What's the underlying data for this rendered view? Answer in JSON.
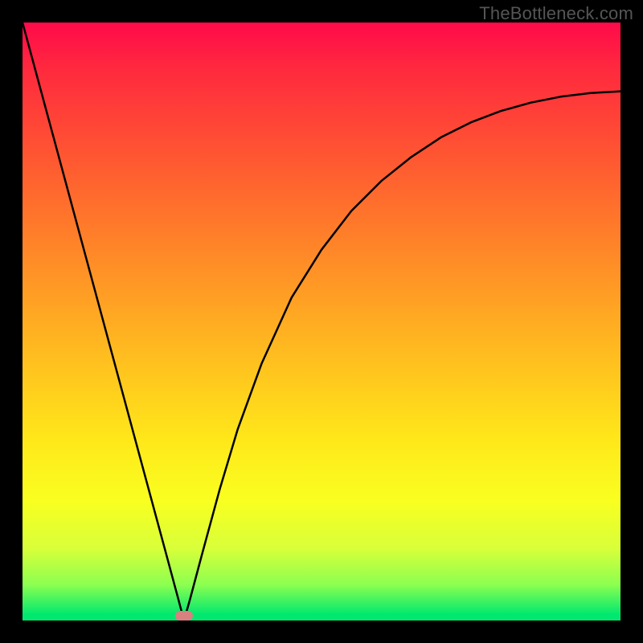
{
  "watermark": "TheBottleneck.com",
  "chart_data": {
    "type": "line",
    "title": "",
    "xlabel": "",
    "ylabel": "",
    "xlim": [
      0,
      100
    ],
    "ylim": [
      0,
      100
    ],
    "grid": false,
    "legend": false,
    "series": [
      {
        "name": "curve",
        "x": [
          0,
          5,
          10,
          15,
          20,
          24,
          26,
          27,
          28,
          30,
          33,
          36,
          40,
          45,
          50,
          55,
          60,
          65,
          70,
          75,
          80,
          85,
          90,
          95,
          100
        ],
        "y": [
          100,
          81.5,
          63,
          44.5,
          26,
          11.2,
          3.8,
          0,
          3.5,
          11,
          22,
          32,
          43,
          54,
          62,
          68.5,
          73.5,
          77.5,
          80.8,
          83.3,
          85.2,
          86.6,
          87.6,
          88.2,
          88.5
        ]
      }
    ],
    "marker": {
      "x": 27,
      "y": 0.8,
      "color": "#d98080"
    },
    "gradient_stops": [
      {
        "pos": 0,
        "color": "#ff0a4a"
      },
      {
        "pos": 8,
        "color": "#ff2a3e"
      },
      {
        "pos": 22,
        "color": "#ff5532"
      },
      {
        "pos": 34,
        "color": "#ff7a2a"
      },
      {
        "pos": 46,
        "color": "#ff9f24"
      },
      {
        "pos": 58,
        "color": "#ffc41e"
      },
      {
        "pos": 70,
        "color": "#ffe81a"
      },
      {
        "pos": 80,
        "color": "#f9ff20"
      },
      {
        "pos": 88,
        "color": "#d8ff3a"
      },
      {
        "pos": 94,
        "color": "#8cff50"
      },
      {
        "pos": 99,
        "color": "#00e86f"
      },
      {
        "pos": 100,
        "color": "#00e86f"
      }
    ]
  }
}
